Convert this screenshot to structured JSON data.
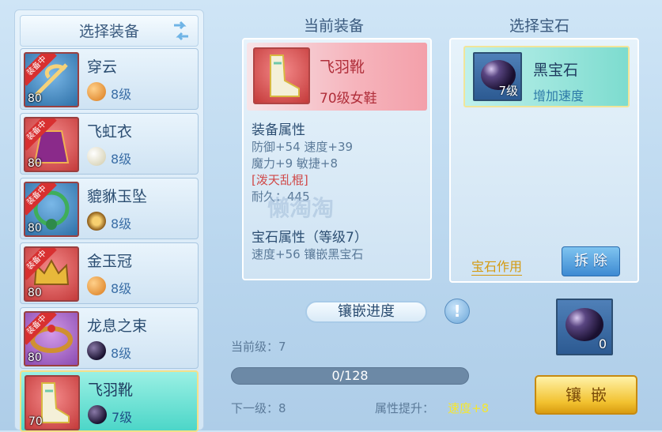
{
  "left_panel": {
    "title": "选择装备",
    "items": [
      {
        "name": "穿云",
        "level": "80",
        "ribbon": "装备中",
        "gem_level": "8级",
        "thumb": "blue",
        "gem": "orange"
      },
      {
        "name": "飞虹衣",
        "level": "80",
        "ribbon": "装备中",
        "gem_level": "8级",
        "thumb": "red",
        "gem": "pearl"
      },
      {
        "name": "貔貅玉坠",
        "level": "80",
        "ribbon": "装备中",
        "gem_level": "8级",
        "thumb": "blue",
        "gem": "ring"
      },
      {
        "name": "金玉冠",
        "level": "80",
        "ribbon": "装备中",
        "gem_level": "8级",
        "thumb": "red",
        "gem": "orange"
      },
      {
        "name": "龙息之束",
        "level": "80",
        "ribbon": "装备中",
        "gem_level": "8级",
        "thumb": "purple",
        "gem": "black"
      },
      {
        "name": "飞羽靴",
        "level": "70",
        "ribbon": "",
        "gem_level": "7级",
        "thumb": "red",
        "gem": "black"
      }
    ]
  },
  "center_panel": {
    "title": "当前装备",
    "equip_name": "飞羽靴",
    "equip_sub": "70级女鞋",
    "attr_title": "装备属性",
    "attr_line1": "防御+54 速度+39",
    "attr_line2": "魔力+9 敏捷+8",
    "special": "[泼天乱棍]",
    "durability": "耐久：445",
    "gem_attr_title": "宝石属性（等级7）",
    "gem_attr_line": "速度+56 镶嵌黑宝石"
  },
  "right_panel": {
    "title": "选择宝石",
    "gem_name": "黑宝石",
    "gem_effect": "增加速度",
    "gem_level": "7级",
    "gem_effect_link": "宝石作用",
    "remove_label": "拆 除"
  },
  "progress": {
    "title": "镶嵌进度",
    "info_icon": "!",
    "current_level": "当前级：7",
    "value_text": "0/128",
    "value_fraction": 0,
    "next_level": "下一级：8",
    "bonus_label": "属性提升：",
    "bonus_value": "速度+8",
    "material_count": "0",
    "inlay_label": "镶嵌"
  },
  "watermark": "懒淘淘",
  "colors": {
    "accent_red": "#b02e3a",
    "bonus_yellow": "#f5e630",
    "button_blue": "#3d8ad2",
    "button_gold": "#f2c230"
  }
}
